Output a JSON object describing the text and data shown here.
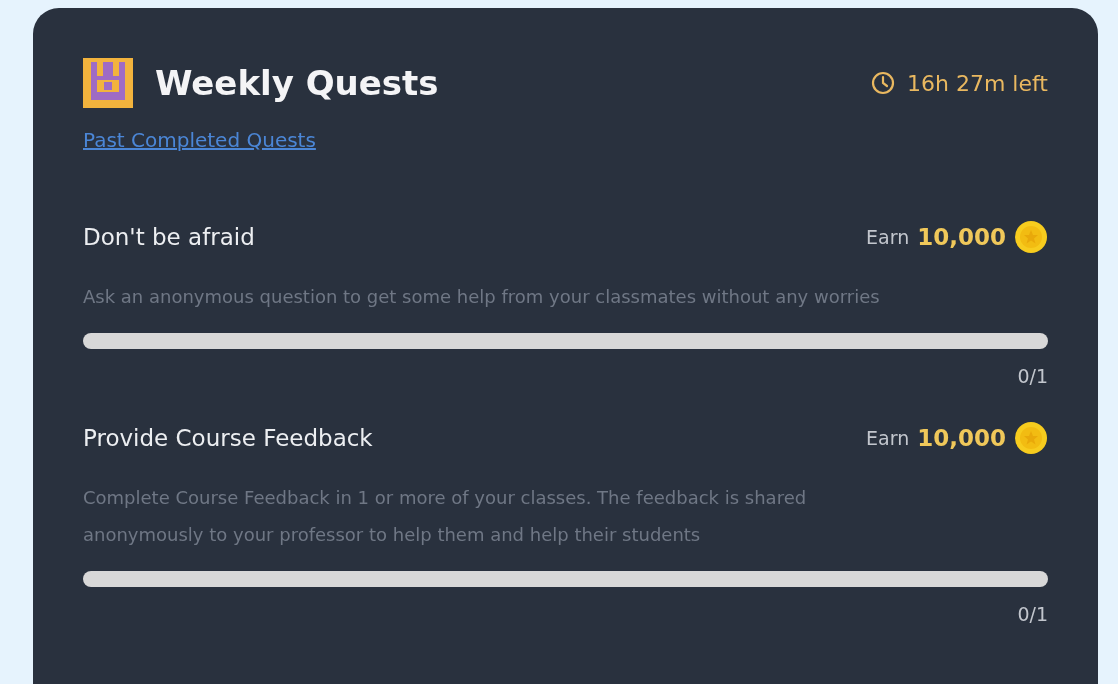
{
  "header": {
    "title": "Weekly Quests",
    "time_left": "16h 27m left"
  },
  "past_link": "Past Completed Quests",
  "quests": [
    {
      "title": "Don't be afraid",
      "earn_label": "Earn",
      "reward": "10,000",
      "description": "Ask an anonymous question to get some help from your classmates without any worries",
      "level": 0,
      "progress": "0/1"
    },
    {
      "title": "Provide Course Feedback",
      "earn_label": "Earn",
      "reward": "10,000",
      "description": "Complete Course Feedback in 1 or more of your classes. The feedback is shared anonymously to your professor to help them and help their students",
      "level": 0,
      "progress": "0/1"
    }
  ]
}
